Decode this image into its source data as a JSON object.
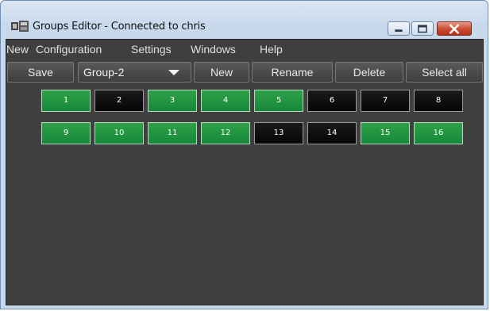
{
  "window": {
    "title": "Groups Editor - Connected to chris",
    "controls": {
      "minimize_icon": "minimize-icon",
      "maximize_icon": "maximize-icon",
      "close_icon": "close-icon"
    }
  },
  "menu": [
    "New",
    "Configuration",
    "Settings",
    "Windows",
    "Help"
  ],
  "toolbar": {
    "save": "Save",
    "group_select": {
      "value": "Group-2"
    },
    "new": "New",
    "rename": "Rename",
    "delete": "Delete",
    "select_all": "Select all"
  },
  "groups": [
    {
      "label": "1",
      "on": true
    },
    {
      "label": "2",
      "on": false
    },
    {
      "label": "3",
      "on": true
    },
    {
      "label": "4",
      "on": true
    },
    {
      "label": "5",
      "on": true
    },
    {
      "label": "6",
      "on": false
    },
    {
      "label": "7",
      "on": false
    },
    {
      "label": "8",
      "on": false
    },
    {
      "label": "9",
      "on": true
    },
    {
      "label": "10",
      "on": true
    },
    {
      "label": "11",
      "on": true
    },
    {
      "label": "12",
      "on": true
    },
    {
      "label": "13",
      "on": false
    },
    {
      "label": "14",
      "on": false
    },
    {
      "label": "15",
      "on": true
    },
    {
      "label": "16",
      "on": true
    }
  ],
  "colors": {
    "on": "#1e9440",
    "off": "#0d0d0d",
    "panel": "#404040"
  }
}
